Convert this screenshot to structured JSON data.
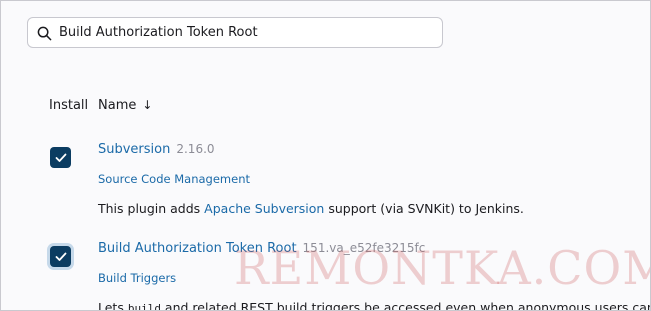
{
  "search": {
    "value": "Build Authorization Token Root",
    "icon": "search-icon"
  },
  "table": {
    "headers": {
      "install": "Install",
      "name": "Name",
      "sort_indicator": "↓"
    }
  },
  "plugins": [
    {
      "name": "Subversion",
      "version": "2.16.0",
      "category": "Source Code Management",
      "checked": true,
      "description": {
        "prefix": "This plugin adds ",
        "link": "Apache Subversion",
        "suffix": " support (via SVNKit) to Jenkins."
      }
    },
    {
      "name": "Build Authorization Token Root",
      "version": "151.va_e52fe3215fc",
      "category": "Build Triggers",
      "checked": true,
      "description": {
        "prefix": "Lets ",
        "code": "build",
        "suffix": " and related REST build triggers be accessed even when anonymous users canno"
      }
    }
  ],
  "watermark": "REMONTKA.COM",
  "colors": {
    "checkbox": "#0b3c61",
    "link": "#1b6aa8",
    "version": "#8c8c96"
  }
}
